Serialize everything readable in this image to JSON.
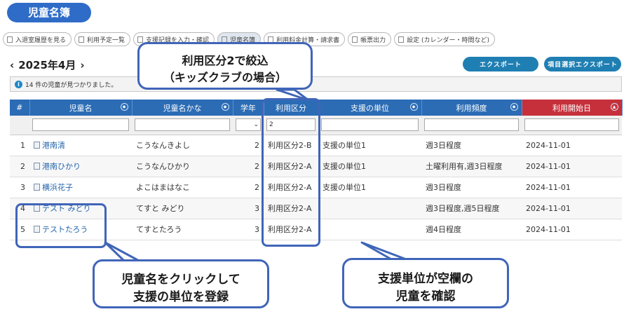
{
  "page_title": "児童名簿",
  "tabs": [
    {
      "label": "入退室履歴を見る",
      "active": false
    },
    {
      "label": "利用予定一覧",
      "active": false
    },
    {
      "label": "支援記録を入力・確認",
      "active": false
    },
    {
      "label": "児童名簿",
      "active": true
    },
    {
      "label": "利用料金計算・請求書",
      "active": false
    },
    {
      "label": "帳票出力",
      "active": false
    },
    {
      "label": "設定 (カレンダー・時間など)",
      "active": false
    }
  ],
  "month_nav": {
    "prev": "‹",
    "label": "2025年4月",
    "next": "›"
  },
  "buttons": {
    "export": "エクスポート",
    "select_export": "項目選択エクスポート"
  },
  "info_text": "14 件の児童が見つかりました。",
  "columns": [
    "#",
    "児童名",
    "児童名かな",
    "学年",
    "利用区分",
    "支援の単位",
    "利用頻度",
    "利用開始日"
  ],
  "filter_values": {
    "usage_category": "2"
  },
  "rows": [
    {
      "no": "1",
      "name": "港南清",
      "kana": "こうなんきよし",
      "grade": "2",
      "category": "利用区分2-B",
      "unit": "支援の単位1",
      "frequency": "週3日程度",
      "start": "2024-11-01"
    },
    {
      "no": "2",
      "name": "港南ひかり",
      "kana": "こうなんひかり",
      "grade": "2",
      "category": "利用区分2-A",
      "unit": "支援の単位1",
      "frequency": "土曜利用有,週3日程度",
      "start": "2024-11-01"
    },
    {
      "no": "3",
      "name": "横浜花子",
      "kana": "よこはまはなこ",
      "grade": "2",
      "category": "利用区分2-A",
      "unit": "支援の単位1",
      "frequency": "週3日程度",
      "start": "2024-11-01"
    },
    {
      "no": "4",
      "name": "テスト みどり",
      "kana": "てすと みどり",
      "grade": "3",
      "category": "利用区分2-A",
      "unit": "",
      "frequency": "週3日程度,週5日程度",
      "start": "2024-11-01"
    },
    {
      "no": "5",
      "name": "テストたろう",
      "kana": "てすとたろう",
      "grade": "3",
      "category": "利用区分2-A",
      "unit": "",
      "frequency": "週4日程度",
      "start": "2024-11-01"
    }
  ],
  "callouts": {
    "filter": {
      "line1": "利用区分2で絞込",
      "line2": "（キッズクラブの場合）"
    },
    "click": {
      "line1": "児童名をクリックして",
      "line2": "支援の単位を登録"
    },
    "blank": {
      "line1": "支援単位が空欄の",
      "line2": "児童を確認"
    }
  },
  "colors": {
    "header": "#2b6cb5",
    "sorted_header": "#c6303b",
    "highlight": "#4065b8",
    "button": "#1f7fb3"
  }
}
